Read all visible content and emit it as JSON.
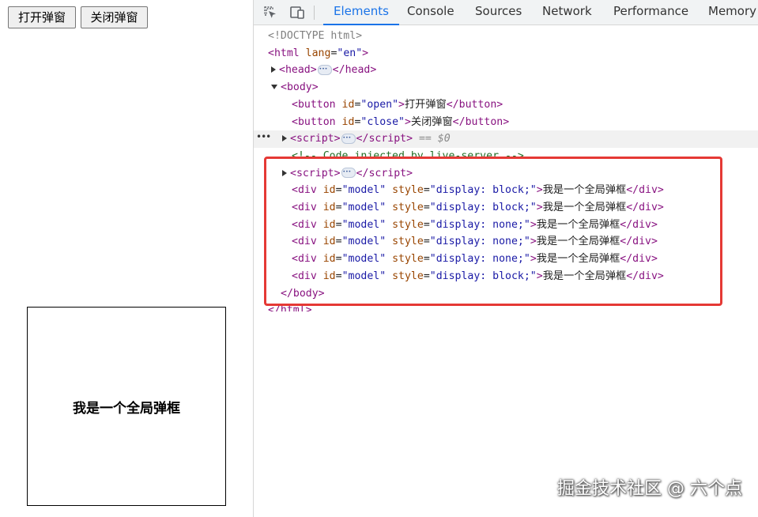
{
  "page": {
    "open_button": "打开弹窗",
    "close_button": "关闭弹窗",
    "modal_text": "我是一个全局弹框"
  },
  "devtools": {
    "tabs": [
      "Elements",
      "Console",
      "Sources",
      "Network",
      "Performance",
      "Memory"
    ],
    "active_tab": "Elements",
    "tree": {
      "doctype": "<!DOCTYPE html>",
      "html_open": "html",
      "lang_attr": "lang",
      "lang_val": "\"en\"",
      "head": "head",
      "body": "body",
      "button_tag": "button",
      "id_attr": "id",
      "open_id": "\"open\"",
      "close_id": "\"close\"",
      "open_text": "打开弹窗",
      "close_text": "关闭弹窗",
      "script_tag": "script",
      "selected_ref": "== $0",
      "comment": "<!-- Code injected by live-server -->",
      "div_tag": "div",
      "model_id": "\"model\"",
      "style_attr": "style",
      "style_block": "\"display: block;\"",
      "style_none": "\"display: none;\"",
      "div_text": "我是一个全局弹框",
      "body_close": "</body>",
      "html_close": "</html>"
    }
  },
  "watermark": "掘金技术社区 @ 六个点",
  "colors": {
    "accent": "#1a73e8",
    "highlight": "#e53935",
    "tag": "#881280",
    "attribute": "#994500",
    "value": "#1a1aa6"
  }
}
